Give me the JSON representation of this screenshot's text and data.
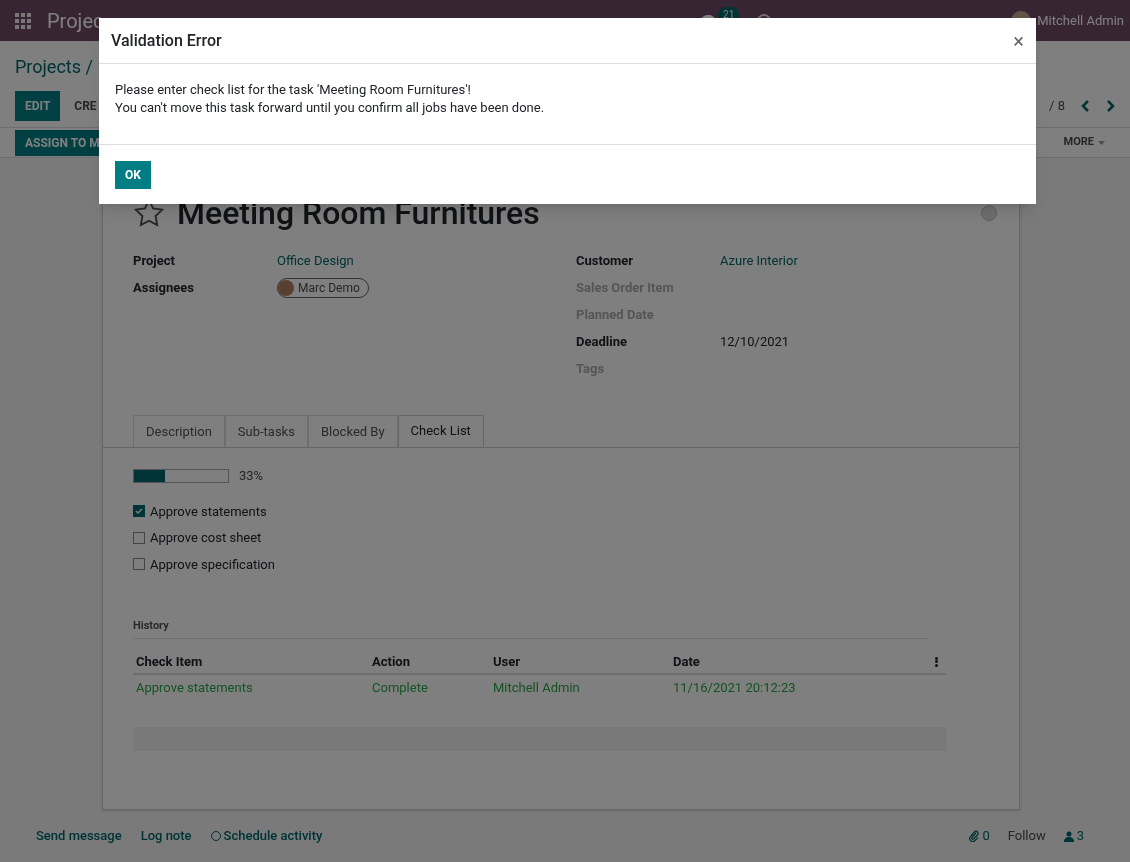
{
  "navbar": {
    "app_title": "Projec",
    "message_count": "21",
    "user": "Mitchell Admin"
  },
  "breadcrumb": "Projects /",
  "buttons": [
    "EDIT",
    "CRE"
  ],
  "pager": "/ 8",
  "status_bar": {
    "actions": [
      "ASSIGN TO M"
    ],
    "more": "MORE"
  },
  "task": {
    "title": "Meeting Room Furnitures",
    "starred": false,
    "fields_left": [
      {
        "label": "Project",
        "value": "Office Design",
        "kind": "link"
      },
      {
        "label": "Assignees",
        "value": "Marc Demo",
        "kind": "tag"
      }
    ],
    "fields_right": [
      {
        "label": "Customer",
        "value": "Azure Interior",
        "kind": "link"
      },
      {
        "label": "Sales Order Item"
      },
      {
        "label": "Planned Date"
      },
      {
        "label": "Deadline",
        "value": "12/10/2021",
        "kind": "text"
      },
      {
        "label": "Tags"
      }
    ],
    "tabs": [
      {
        "label": "Description",
        "selected": false
      },
      {
        "label": "Sub-tasks",
        "selected": false
      },
      {
        "label": "Blocked By",
        "selected": false
      },
      {
        "label": "Check List",
        "selected": true
      }
    ],
    "progress": {
      "level": 0.33,
      "reading": "33%"
    },
    "checklist": [
      {
        "label": "Approve statements",
        "checked": true
      },
      {
        "label": "Approve cost sheet",
        "checked": false
      },
      {
        "label": "Approve specification",
        "checked": false
      }
    ],
    "history": {
      "title": "History",
      "columns": [
        "Check Item",
        "Action",
        "User",
        "Date"
      ],
      "rows": [
        [
          "Approve statements",
          "Complete",
          "Mitchell Admin",
          "11/16/2021 20:12:23"
        ]
      ]
    }
  },
  "chatter": {
    "actions": [
      "Send message",
      "Log note",
      "Schedule activity"
    ],
    "attachments": "0",
    "follow": "Follow",
    "followers": "3"
  },
  "dialog": {
    "title": "Validation Error",
    "close": "×",
    "lines": [
      "Please enter check list for the task 'Meeting Room Furnitures'!",
      "You can't move this task forward until you confirm all jobs have been done."
    ],
    "button": "OK"
  }
}
